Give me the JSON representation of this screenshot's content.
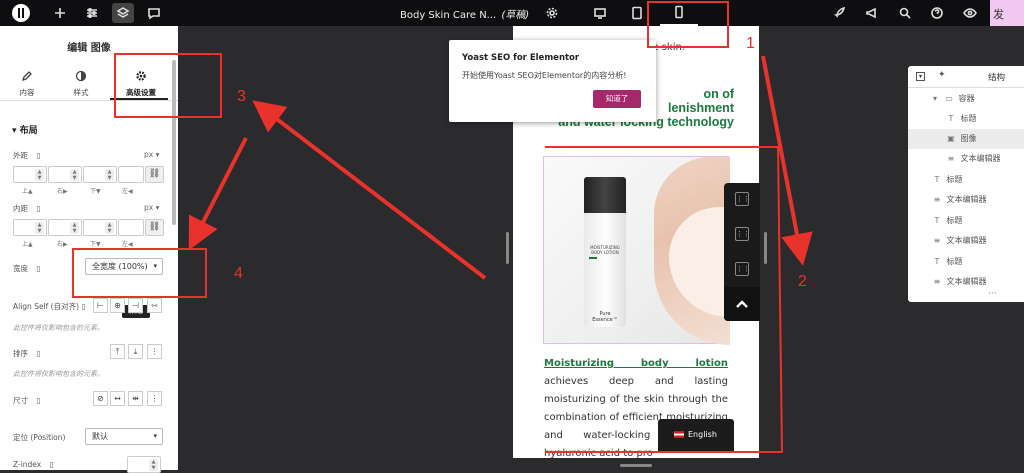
{
  "topbar": {
    "doc_title": "Body Skin Care N...",
    "doc_status": "(草稿)",
    "publish_label": "发",
    "device_active": "mobile"
  },
  "panel": {
    "title": "编辑 图像",
    "tabs": [
      {
        "label": "内容",
        "icon": "pencil-icon"
      },
      {
        "label": "样式",
        "icon": "half-circle-icon"
      },
      {
        "label": "高级设置",
        "icon": "gear-icon",
        "active": true
      }
    ],
    "section_title": "布局",
    "margin": {
      "label": "外距",
      "unit": "px",
      "sides": [
        "上",
        "右",
        "下",
        "左"
      ]
    },
    "padding": {
      "label": "内距",
      "unit": "px",
      "sides": [
        "上",
        "右",
        "下",
        "左"
      ]
    },
    "width": {
      "label": "宽度",
      "value": "全宽度 (100%)"
    },
    "tooltip": "末端",
    "align_self": {
      "label": "Align Self (自对齐)",
      "note": "此控件将仅影响包含的元素。"
    },
    "order": {
      "label": "排序",
      "note": "此控件将仅影响包含的元素。"
    },
    "size": {
      "label": "尺寸"
    },
    "position": {
      "label": "定位 (Position)",
      "value": "默认"
    },
    "zindex": {
      "label": "Z-index"
    }
  },
  "canvas": {
    "hero_text": "e skin.",
    "heading": "on of\nlenishment\nand water locking technology",
    "bottle_line1": "MOISTURIZING",
    "bottle_line2": "BODY LOTION",
    "bottle_brand": "Pure Essence™",
    "body_link": "Moisturizing body lotion",
    "body_text": " achieves deep and lasting moisturizing of the skin through the combination of efficient moisturizing and water-locking technology. hyaluronic acid to pro"
  },
  "yoast": {
    "title": "Yoast SEO for Elementor",
    "description": "开始使用Yoast SEO对Elementor的内容分析!",
    "button": "知道了"
  },
  "language": {
    "label": "English"
  },
  "structure": {
    "title": "结构",
    "items": [
      {
        "label": "容器",
        "icon": "container-icon"
      },
      {
        "label": "标题",
        "icon": "heading-icon"
      },
      {
        "label": "图像",
        "icon": "image-icon"
      },
      {
        "label": "文本编辑器",
        "icon": "text-editor-icon"
      },
      {
        "label": "标题",
        "icon": "heading-icon"
      },
      {
        "label": "文本编辑器",
        "icon": "text-editor-icon"
      },
      {
        "label": "标题",
        "icon": "heading-icon"
      },
      {
        "label": "文本编辑器",
        "icon": "text-editor-icon"
      },
      {
        "label": "标题",
        "icon": "heading-icon"
      },
      {
        "label": "文本编辑器",
        "icon": "text-editor-icon"
      }
    ]
  },
  "annotations": {
    "color": "#e8322b",
    "numbers": [
      "1",
      "2",
      "3",
      "4"
    ]
  },
  "colors": {
    "accent_green": "#1b7a3e",
    "yoast_button": "#a4286a",
    "publish_bg": "#f3c8f2"
  }
}
